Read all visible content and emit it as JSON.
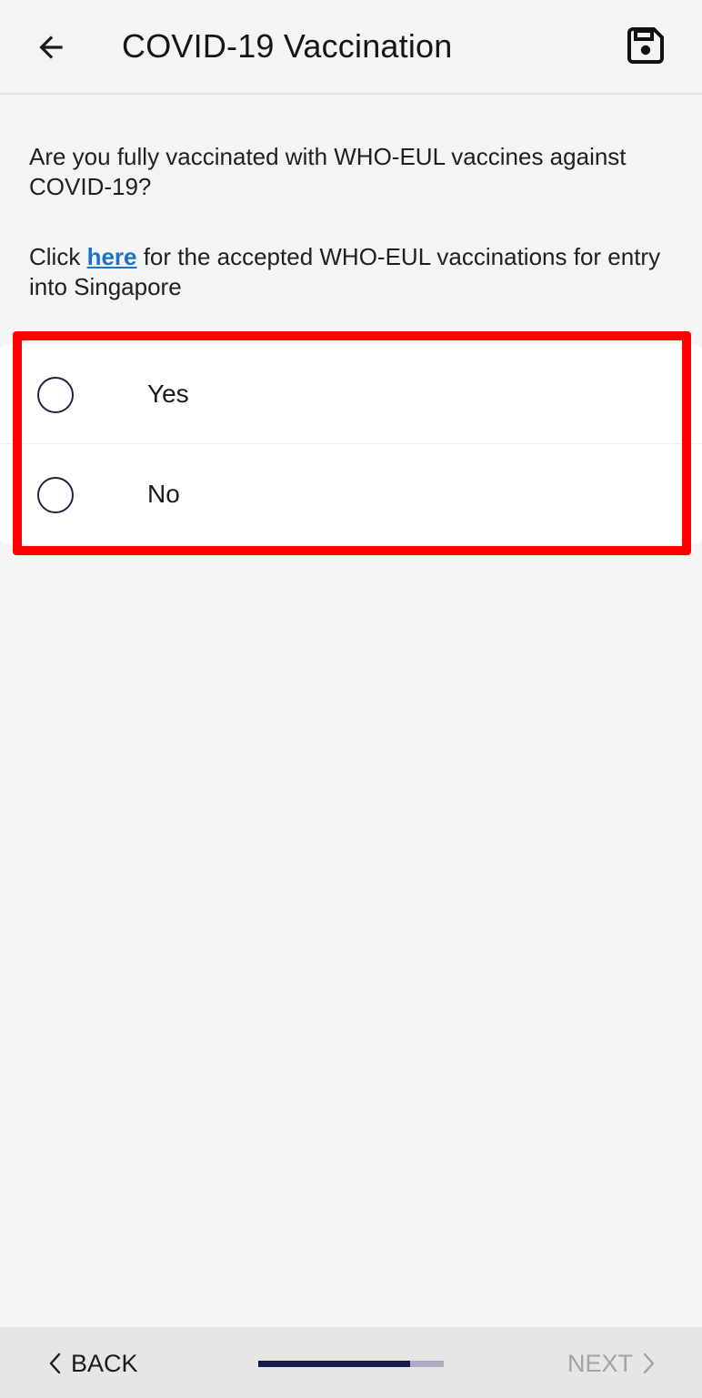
{
  "header": {
    "title": "COVID-19 Vaccination",
    "back_icon": "arrow-left-icon",
    "save_icon": "floppy-disk-icon"
  },
  "question": {
    "text": "Are you fully vaccinated with WHO-EUL vaccines against COVID-19?"
  },
  "hint": {
    "prefix": "Click ",
    "link_text": "here",
    "suffix": " for the accepted WHO-EUL vaccinations for entry into Singapore"
  },
  "options": [
    {
      "label": "Yes",
      "selected": false
    },
    {
      "label": "No",
      "selected": false
    }
  ],
  "footer": {
    "back_label": "BACK",
    "next_label": "NEXT",
    "next_enabled": false,
    "progress_fraction": 0.82
  },
  "colors": {
    "link": "#1a73c9",
    "highlight": "#ff0000",
    "progress_fill": "#151b4d",
    "progress_track": "#a9adbd"
  }
}
